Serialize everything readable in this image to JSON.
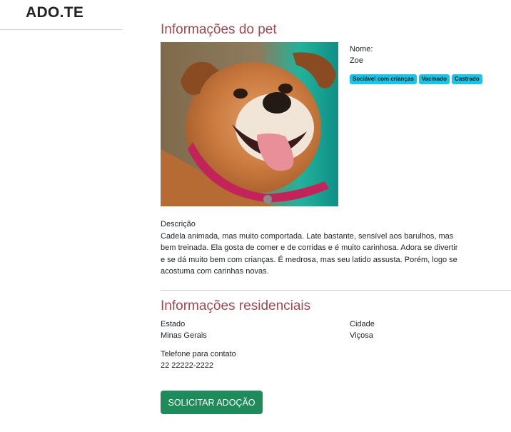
{
  "brand": "ADO.TE",
  "pet_section": {
    "title": "Informações do pet",
    "photo_subject": "dog",
    "name_label": "Nome:",
    "name_value": "Zoe",
    "tags": [
      "Sociável com crianças",
      "Vacinado",
      "Castrado"
    ],
    "description_label": "Descrição",
    "description_text": "Cadela animada, mas muito comportada. Late bastante, sensível aos barulhos, mas bem treinada. Ela gosta de comer e de corridas e é muito carinhosa. Adora se divertir e se dá muito bem com crianças. É medrosa, mas seu latido assusta. Porém, logo se acostuma com carinhas novas."
  },
  "residential_section": {
    "title": "Informações residenciais",
    "state_label": "Estado",
    "state_value": "Minas Gerais",
    "city_label": "Cidade",
    "city_value": "Viçosa",
    "phone_label": "Telefone para contato",
    "phone_value": "22 22222-2222"
  },
  "adopt_button_label": "SOLICITAR ADOÇÃO",
  "colors": {
    "section_title": "#9e4a4f",
    "tag_bg": "#16c6e8",
    "button_bg": "#1f8a5a"
  }
}
